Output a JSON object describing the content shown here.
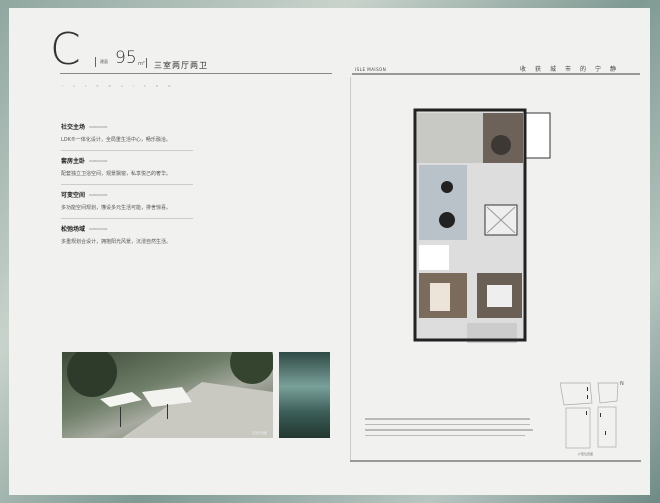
{
  "header": {
    "letter": "C",
    "area_label": "建面",
    "area_value": "95",
    "area_unit": "m²",
    "layout_type": "三室两厅两卫",
    "dots": "ISLEMAISON"
  },
  "brand": {
    "name": "ISLE MAISON",
    "slogan": "收获城市的宁静"
  },
  "features": [
    {
      "title": "社交主场",
      "tag": "ISLEMAISON",
      "desc": "LDK®一体化设计，全局重生活中心，畅乐融洽。"
    },
    {
      "title": "套房主卧",
      "tag": "ISLEMAISON",
      "desc": "配套独立卫浴空间，观景飘窗，私享悦己的奢华。"
    },
    {
      "title": "可变空间",
      "tag": "ISLEMAISON",
      "desc": "多功能空间规划，懂设多元生活可能，排舍惊喜。"
    },
    {
      "title": "松弛场域",
      "tag": "ISLEMAISON",
      "desc": "多重规划合设计，拥抱阳光风景，沉浸自然生活。"
    }
  ],
  "keyplan": {
    "caption": "户型位置图",
    "compass": "N"
  },
  "photo_caption": "实景示意图"
}
